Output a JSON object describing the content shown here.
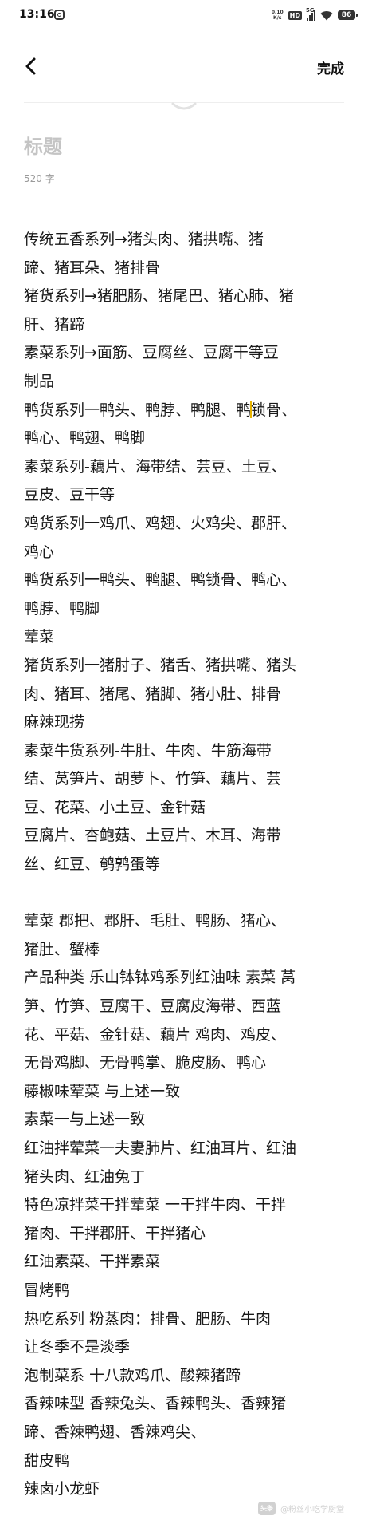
{
  "status_bar": {
    "time": "13:16",
    "net_speed_value": "0.10",
    "net_speed_unit": "K/s",
    "hd": "HD",
    "network": "5G",
    "battery": "86"
  },
  "nav": {
    "done_label": "完成"
  },
  "editor": {
    "title_placeholder": "标题",
    "word_count": "520 字"
  },
  "lines": [
    "传统五香系列→猪头肉、猪拱嘴、猪",
    "蹄、猪耳朵、猪排骨",
    "猪货系列→猪肥肠、猪尾巴、猪心肺、猪",
    "肝、猪蹄",
    "素菜系列→面筋、豆腐丝、豆腐干等豆",
    "制品",
    "鸭货系列一鸭头、鸭脖、鸭腿、鸭锁骨、",
    "鸭心、鸭翅、鸭脚",
    "素菜系列-藕片、海带结、芸豆、土豆、",
    "豆皮、豆干等",
    "鸡货系列一鸡爪、鸡翅、火鸡尖、郡肝、",
    "鸡心",
    "鸭货系列一鸭头、鸭腿、鸭锁骨、鸭心、",
    "鸭脖、鸭脚",
    "荤菜",
    "猪货系列一猪肘子、猪舌、猪拱嘴、猪头",
    "肉、猪耳、猪尾、猪脚、猪小肚、排骨",
    "麻辣现捞",
    "素菜牛货系列-牛肚、牛肉、牛筋海带",
    "结、莴笋片、胡萝卜、竹笋、藕片、芸",
    "豆、花菜、小土豆、金针菇",
    "豆腐片、杏鲍菇、土豆片、木耳、海带",
    "丝、红豆、鹌鹑蛋等",
    "",
    "荤菜 郡把、郡肝、毛肚、鸭肠、猪心、",
    "猪肚、蟹棒",
    "产品种类 乐山钵钵鸡系列红油味 素菜 莴",
    "笋、竹笋、豆腐干、豆腐皮海带、西蓝",
    "花、平菇、金针菇、藕片 鸡肉、鸡皮、",
    "无骨鸡脚、无骨鸭掌、脆皮肠、鸭心",
    "藤椒味荤菜 与上述一致",
    "素菜一与上述一致",
    "红油拌荤菜一夫妻肺片、红油耳片、红油",
    "猪头肉、红油兔丁",
    "特色凉拌菜干拌荤菜 一干拌牛肉、干拌",
    "猪肉、干拌郡肝、干拌猪心",
    "红油素菜、干拌素菜",
    "冒烤鸭",
    "热吃系列 粉蒸肉：排骨、肥肠、牛肉",
    "让冬季不是淡季",
    "泡制菜系 十八款鸡爪、酸辣猪蹄",
    "香辣味型 香辣兔头、香辣鸭头、香辣猪",
    "蹄、香辣鸭翅、香辣鸡尖、",
    "甜皮鸭",
    "辣卤小龙虾"
  ],
  "cursor_line": 6,
  "cursor_after_chars": 15,
  "watermark": {
    "logo": "头条",
    "text": "@粉丝小吃学厨堂"
  },
  "colors": {
    "cursor": "#e8b400",
    "title_placeholder": "#c4c4c4",
    "text": "#1a1a1a"
  }
}
